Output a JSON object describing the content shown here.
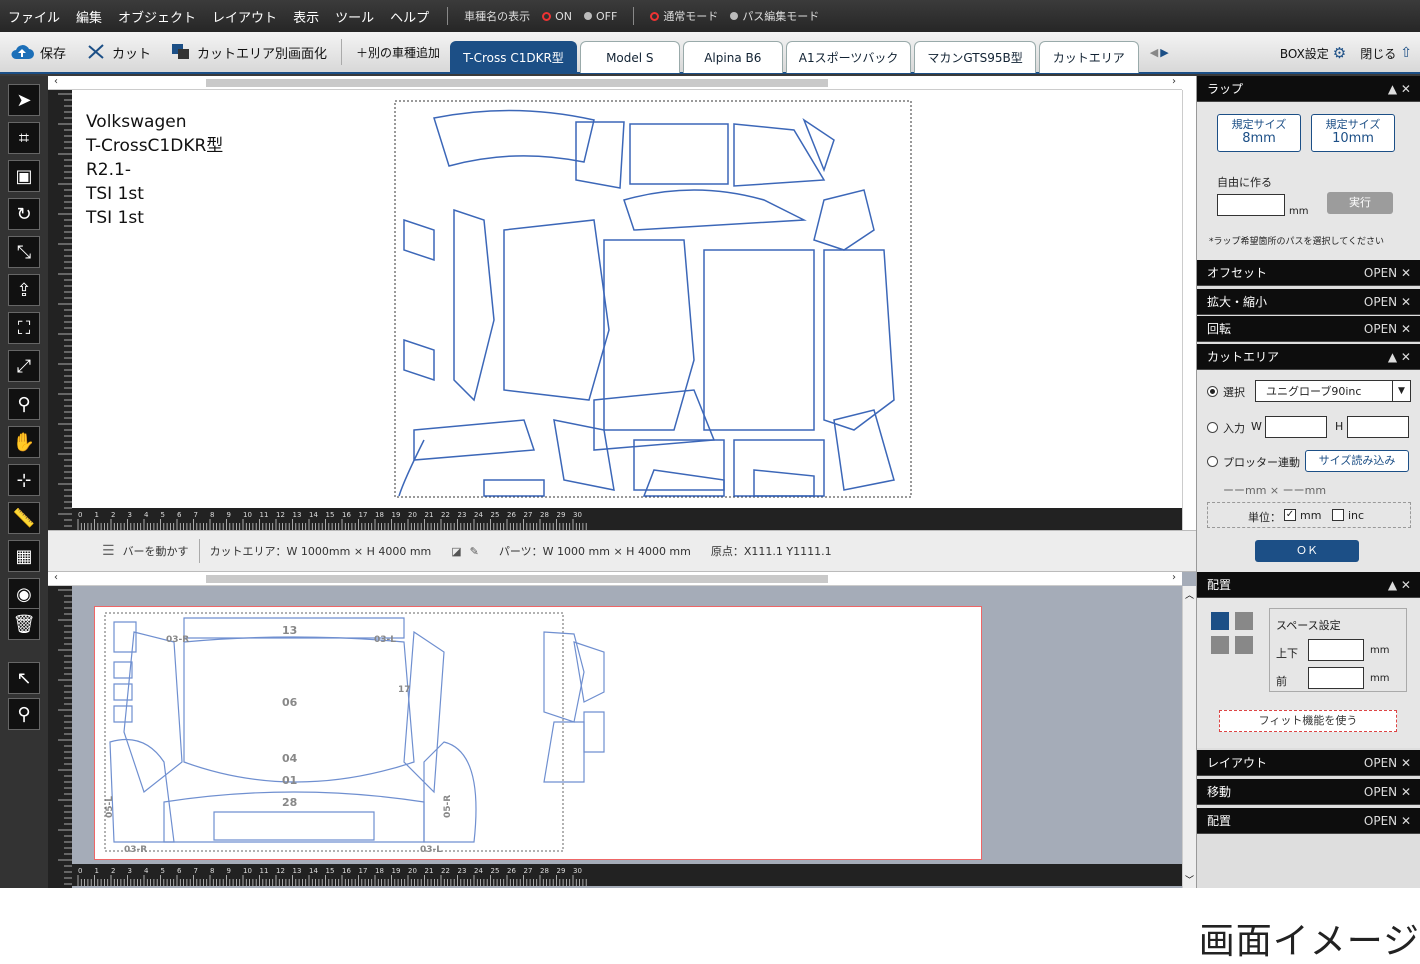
{
  "menu": {
    "items": [
      "ファイル",
      "編集",
      "オブジェクト",
      "レイアウト",
      "表示",
      "ツール",
      "ヘルプ"
    ],
    "model_name_display": "車種名の表示",
    "on_label": "ON",
    "off_label": "OFF",
    "normal_mode": "通常モード",
    "path_edit_mode": "パス編集モード"
  },
  "toolbar": {
    "save": "保存",
    "cut": "カット",
    "cut_area_window": "カットエリア別画面化",
    "add_model": "＋別の車種追加",
    "tabs": [
      "T-Cross C1DKR型",
      "Model S",
      "Alpina B6",
      "A1スポーツバック",
      "マカンGTS95B型",
      "カットエリア"
    ],
    "box_settings": "BOX設定",
    "close": "閉じる"
  },
  "vehicle_text": [
    "Volkswagen",
    "T-CrossC1DKR型",
    "R2.1-",
    "TSI 1st",
    "TSI 1st"
  ],
  "status": {
    "move_bar": "バーを動かす",
    "cut_area": "カットエリア：W 1000mm × H 4000 mm",
    "parts": "パーツ：W 1000 mm × H 4000 mm",
    "origin": "原点：X111.1 Y1111.1"
  },
  "ruler_labels": [
    "0",
    "1",
    "2",
    "3",
    "4",
    "5",
    "6",
    "7",
    "8",
    "9",
    "10",
    "11",
    "12",
    "13",
    "14",
    "15",
    "16",
    "17",
    "18",
    "19",
    "20",
    "21",
    "22",
    "23",
    "24",
    "25",
    "26",
    "27",
    "28",
    "29",
    "30"
  ],
  "lower_parts": {
    "p13": "13",
    "p06": "06",
    "p04": "04",
    "p01": "01",
    "p28": "28",
    "p03r_top": "03-R",
    "p03l_top": "03-L",
    "p05l": "05-L",
    "p05r": "05-R",
    "p03r_bot": "03-R",
    "p03l_bot": "03-L",
    "p17": "17"
  },
  "panels": {
    "wrap": {
      "title": "ラップ",
      "size8": [
        "規定サイズ",
        "8mm"
      ],
      "size10": [
        "規定サイズ",
        "10mm"
      ],
      "free": "自由に作る",
      "mm": "mm",
      "run": "実行",
      "note": "*ラップ希望箇所のパスを選択してください"
    },
    "offset": {
      "title": "オフセット",
      "open": "OPEN ✕"
    },
    "scale": {
      "title": "拡大・縮小",
      "open": "OPEN ✕"
    },
    "rotate": {
      "title": "回転",
      "open": "OPEN ✕"
    },
    "cutarea": {
      "title": "カットエリア",
      "select": "選択",
      "select_value": "ユニグローブ90inc",
      "input": "入力",
      "w": "W",
      "h": "H",
      "plotter": "プロッター連動",
      "read_size": "サイズ読み込み",
      "dims": "ーーmm × ーーmm",
      "unit": "単位：",
      "unit_mm": "mm",
      "unit_inc": "inc",
      "ok": "ＯＫ"
    },
    "placement": {
      "title": "配置",
      "space": "スペース設定",
      "topbottom": "上下",
      "front": "前",
      "mm": "mm",
      "fit": "フィット機能を使う"
    },
    "layout": {
      "title": "レイアウト",
      "open": "OPEN ✕"
    },
    "move": {
      "title": "移動",
      "open": "OPEN ✕"
    },
    "arrange": {
      "title": "配置",
      "open": "OPEN ✕"
    }
  },
  "caption": "画面イメージ",
  "colors": {
    "accent": "#1c4f86",
    "parts": "#3c67b8"
  }
}
